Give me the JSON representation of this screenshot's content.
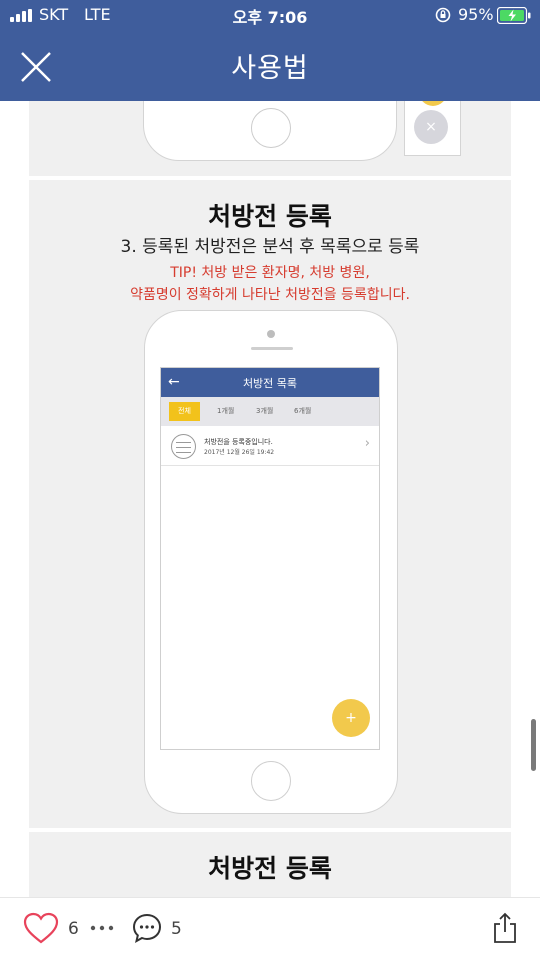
{
  "status_bar": {
    "carrier": "SKT",
    "network": "LTE",
    "time": "오후 7:06",
    "battery_percent": "95%",
    "icons": [
      "signal-icon",
      "orientation-lock-icon",
      "battery-charging-icon"
    ]
  },
  "header": {
    "title": "사용법",
    "close_icon": "close-icon",
    "background_color": "#3f5d9c"
  },
  "sections": [
    {
      "title": "처방전 등록",
      "step": "3. 등록된 처방전은 분석 후 목록으로 등록",
      "tip_line1": "TIP! 처방 받은 환자명, 처방 병원,",
      "tip_line2": "약품명이 정확하게 나타난 처방전을 등록합니다.",
      "tip_color": "#d63c2f",
      "mockup": {
        "screen_title": "처방전 목록",
        "tabs": [
          "전체",
          "1개월",
          "3개월",
          "6개월"
        ],
        "active_tab": "전체",
        "list": [
          {
            "title": "처방전을 등록중입니다.",
            "date": "2017년 12월 26일 19:42"
          }
        ],
        "fab_label": "+",
        "accent_color": "#f2c21b"
      }
    },
    {
      "title": "처방전 등록"
    }
  ],
  "top_panel": {
    "close_dot_label": "×"
  },
  "bottom_bar": {
    "like_count": "6",
    "comment_count": "5",
    "icons": [
      "heart-icon",
      "more-icon",
      "comment-icon",
      "share-icon"
    ]
  }
}
